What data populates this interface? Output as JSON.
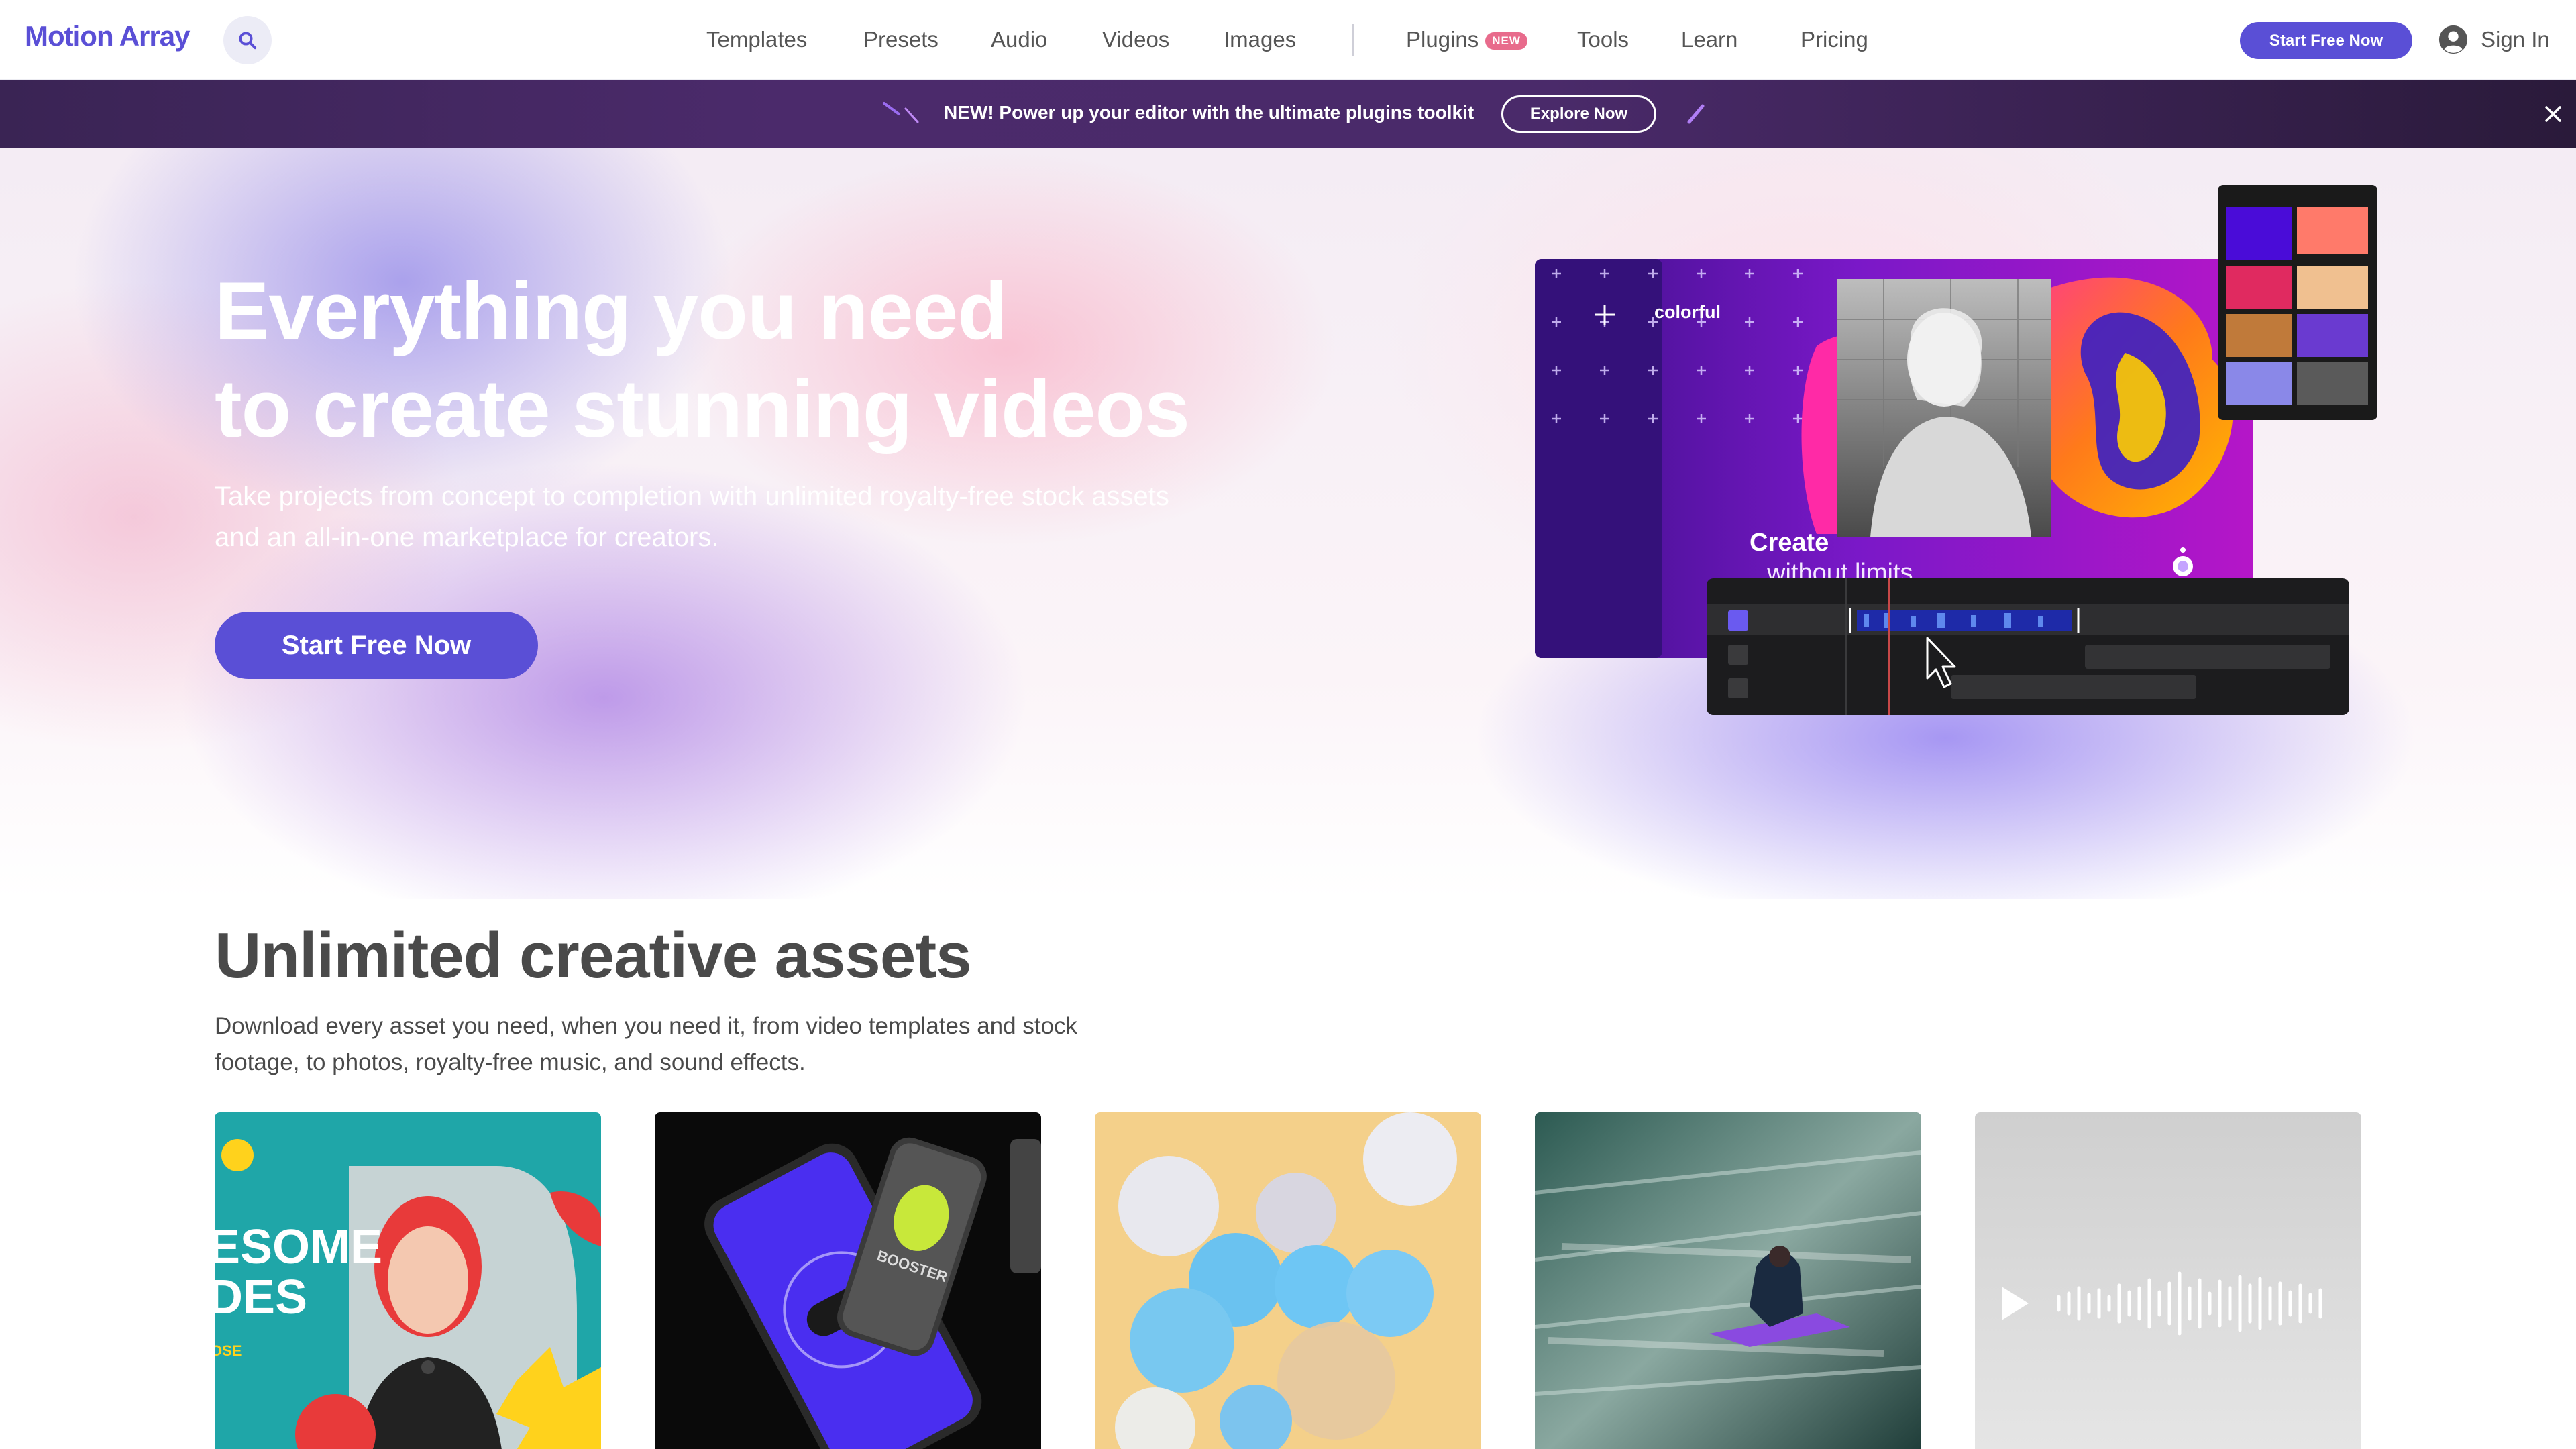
{
  "header": {
    "logo": "Motion Array",
    "nav": [
      "Templates",
      "Presets",
      "Audio",
      "Videos",
      "Images",
      "Plugins",
      "Tools",
      "Learn",
      "Pricing"
    ],
    "plugins_badge": "NEW",
    "cta": "Start Free Now",
    "sign_in": "Sign In"
  },
  "promo": {
    "text": "NEW! Power up your editor with the ultimate plugins toolkit",
    "button": "Explore Now"
  },
  "hero": {
    "title_line1": "Everything you need",
    "title_line2": "to create stunning videos",
    "subtitle": "Take projects from concept to completion with unlimited royalty-free stock assets and an all-in-one marketplace for creators.",
    "cta": "Start Free Now",
    "visual": {
      "tag": "colorful",
      "caption_line1": "Create",
      "caption_line2": "without limits"
    }
  },
  "assets": {
    "title": "Unlimited creative assets",
    "subtitle": "Download every asset you need, when you need it, from video templates and stock footage, to photos, royalty-free music, and sound effects.",
    "card1_text_a": "ESOME",
    "card1_text_b": "DES",
    "card1_text_c": "OSE",
    "card2_text": "BOOSTER"
  },
  "colors": {
    "brand": "#5a4fd6",
    "promo_bg": "#3a2454",
    "badge": "#e86b8c"
  }
}
